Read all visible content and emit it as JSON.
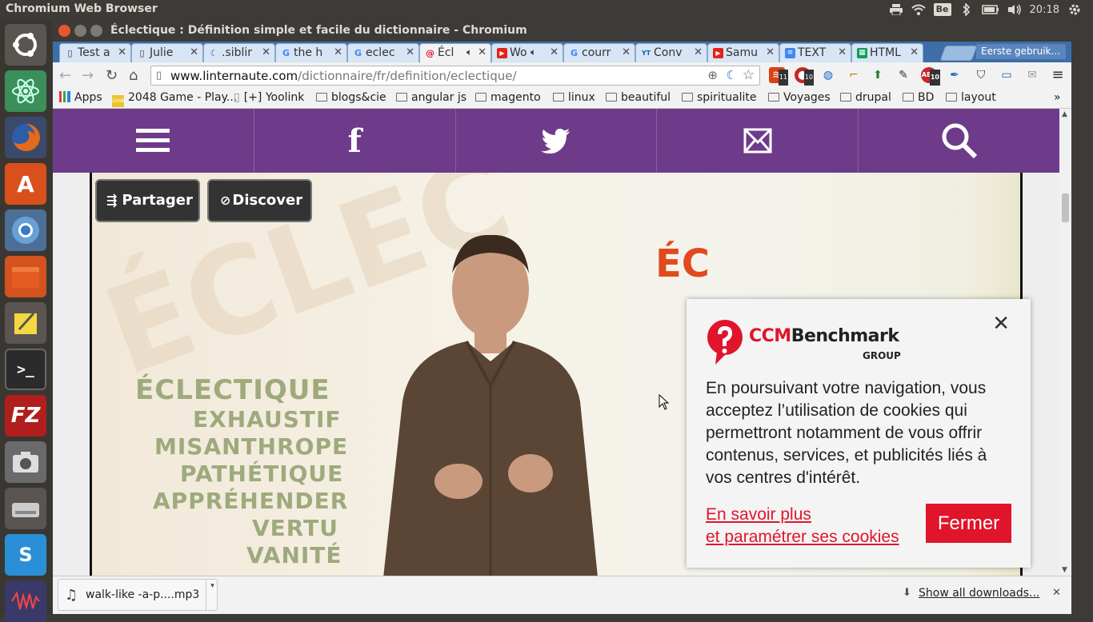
{
  "system": {
    "app_name": "Chromium Web Browser",
    "clock": "20:18",
    "keyboard": "Be"
  },
  "window": {
    "title": "Éclectique : Définition simple et facile du dictionnaire - Chromium"
  },
  "tabs": [
    {
      "label": "Test a",
      "icon": "page-icon"
    },
    {
      "label": "Julie",
      "icon": "page-icon"
    },
    {
      "label": ".siblir",
      "icon": "moon-icon"
    },
    {
      "label": "the h",
      "icon": "google-icon"
    },
    {
      "label": "eclec",
      "icon": "google-icon"
    },
    {
      "label": "Écl",
      "icon": "linternaute-icon"
    },
    {
      "label": "Wo",
      "icon": "youtube-icon"
    },
    {
      "label": "courr",
      "icon": "google-icon"
    },
    {
      "label": "Conv",
      "icon": "yt-mp3-icon"
    },
    {
      "label": "Samu",
      "icon": "youtube-icon"
    },
    {
      "label": "TEXT",
      "icon": "docs-icon"
    },
    {
      "label": "HTML",
      "icon": "sheets-icon"
    }
  ],
  "profile_button": "Eerste gebruik...",
  "address": {
    "domain": "www.linternaute.com",
    "path": "/dictionnaire/fr/definition/eclectique/"
  },
  "extension_badges": {
    "ext1": "11",
    "ext2": "10",
    "abp": "10"
  },
  "bookmarks": [
    {
      "label": "Apps",
      "type": "apps"
    },
    {
      "label": "2048 Game - Play...",
      "type": "site"
    },
    {
      "label": "[+] Yoolink",
      "type": "page"
    },
    {
      "label": "blogs&cie",
      "type": "folder"
    },
    {
      "label": "angular js",
      "type": "folder"
    },
    {
      "label": "magento",
      "type": "folder"
    },
    {
      "label": "linux",
      "type": "folder"
    },
    {
      "label": "beautiful",
      "type": "folder"
    },
    {
      "label": "spiritualite",
      "type": "folder"
    },
    {
      "label": "Voyages",
      "type": "folder"
    },
    {
      "label": "drupal",
      "type": "folder"
    },
    {
      "label": "BD",
      "type": "folder"
    },
    {
      "label": "layout",
      "type": "folder"
    }
  ],
  "bookmarks_more": "»",
  "site_nav": {
    "menu": "menu-icon",
    "facebook": "f",
    "twitter": "twitter-icon",
    "mail": "mail-icon",
    "search": "search-icon"
  },
  "video": {
    "share_label": "Partager",
    "discover_label": "Discover",
    "words": [
      "ÉCLECTIQUE",
      "EXHAUSTIF",
      "MISANTHROPE",
      "PATHÉTIQUE",
      "APPRÉHENDER",
      "VERTU",
      "VANITÉ"
    ],
    "orange_text": "ÉC",
    "bg_text": "ÉCLEC"
  },
  "cookie": {
    "brand_ccm": "CCM",
    "brand_benchmark": "Benchmark",
    "brand_group": "GROUP",
    "close": "✕",
    "message": "En poursuivant votre navigation, vous acceptez l’utilisation de cookies qui permettront notamment de vous offrir contenus, services, et publicités liés à vos centres d'intérêt.",
    "link_line1": "En savoir plus",
    "link_line2": "et paramétrer ses cookies",
    "button": "Fermer",
    "accent": "#e0142b"
  },
  "download": {
    "file": "walk-like -a-p....mp3",
    "show_all": "Show all downloads...",
    "close": "✕"
  },
  "colors": {
    "purple": "#6e3b8a",
    "tab_strip": "#3d6ea8"
  }
}
